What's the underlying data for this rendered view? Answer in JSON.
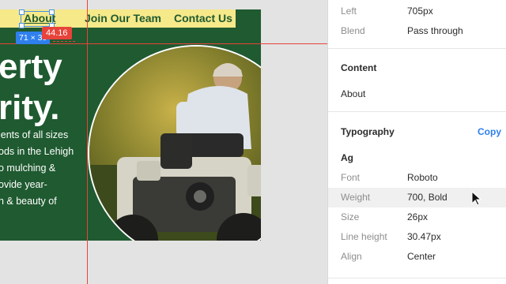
{
  "canvas": {
    "nav": {
      "about": "About",
      "join": "Join Our Team",
      "contact": "Contact Us"
    },
    "hero": {
      "title_line1": "erty",
      "title_line2": "rity.",
      "body_lines": [
        "ients of all sizes",
        "ods in the Lehigh",
        "o mulching &",
        "ovide year-",
        "h & beauty of"
      ]
    },
    "selection": {
      "dimensions": "71 × 30",
      "distance": "44.16"
    },
    "colors": {
      "brand_green": "#1f5a30",
      "nav_yellow": "#f5e98a",
      "guide_red": "#e8433a",
      "selection_blue": "#2f80ed"
    }
  },
  "inspector": {
    "layout": {
      "left_label": "Left",
      "left_value": "705px",
      "blend_label": "Blend",
      "blend_value": "Pass through"
    },
    "content": {
      "title": "Content",
      "value": "About"
    },
    "typography": {
      "title": "Typography",
      "copy_label": "Copy",
      "preview": "Ag",
      "font_label": "Font",
      "font_value": "Roboto",
      "weight_label": "Weight",
      "weight_value": "700, Bold",
      "size_label": "Size",
      "size_value": "26px",
      "line_height_label": "Line height",
      "line_height_value": "30.47px",
      "align_label": "Align",
      "align_value": "Center"
    }
  }
}
